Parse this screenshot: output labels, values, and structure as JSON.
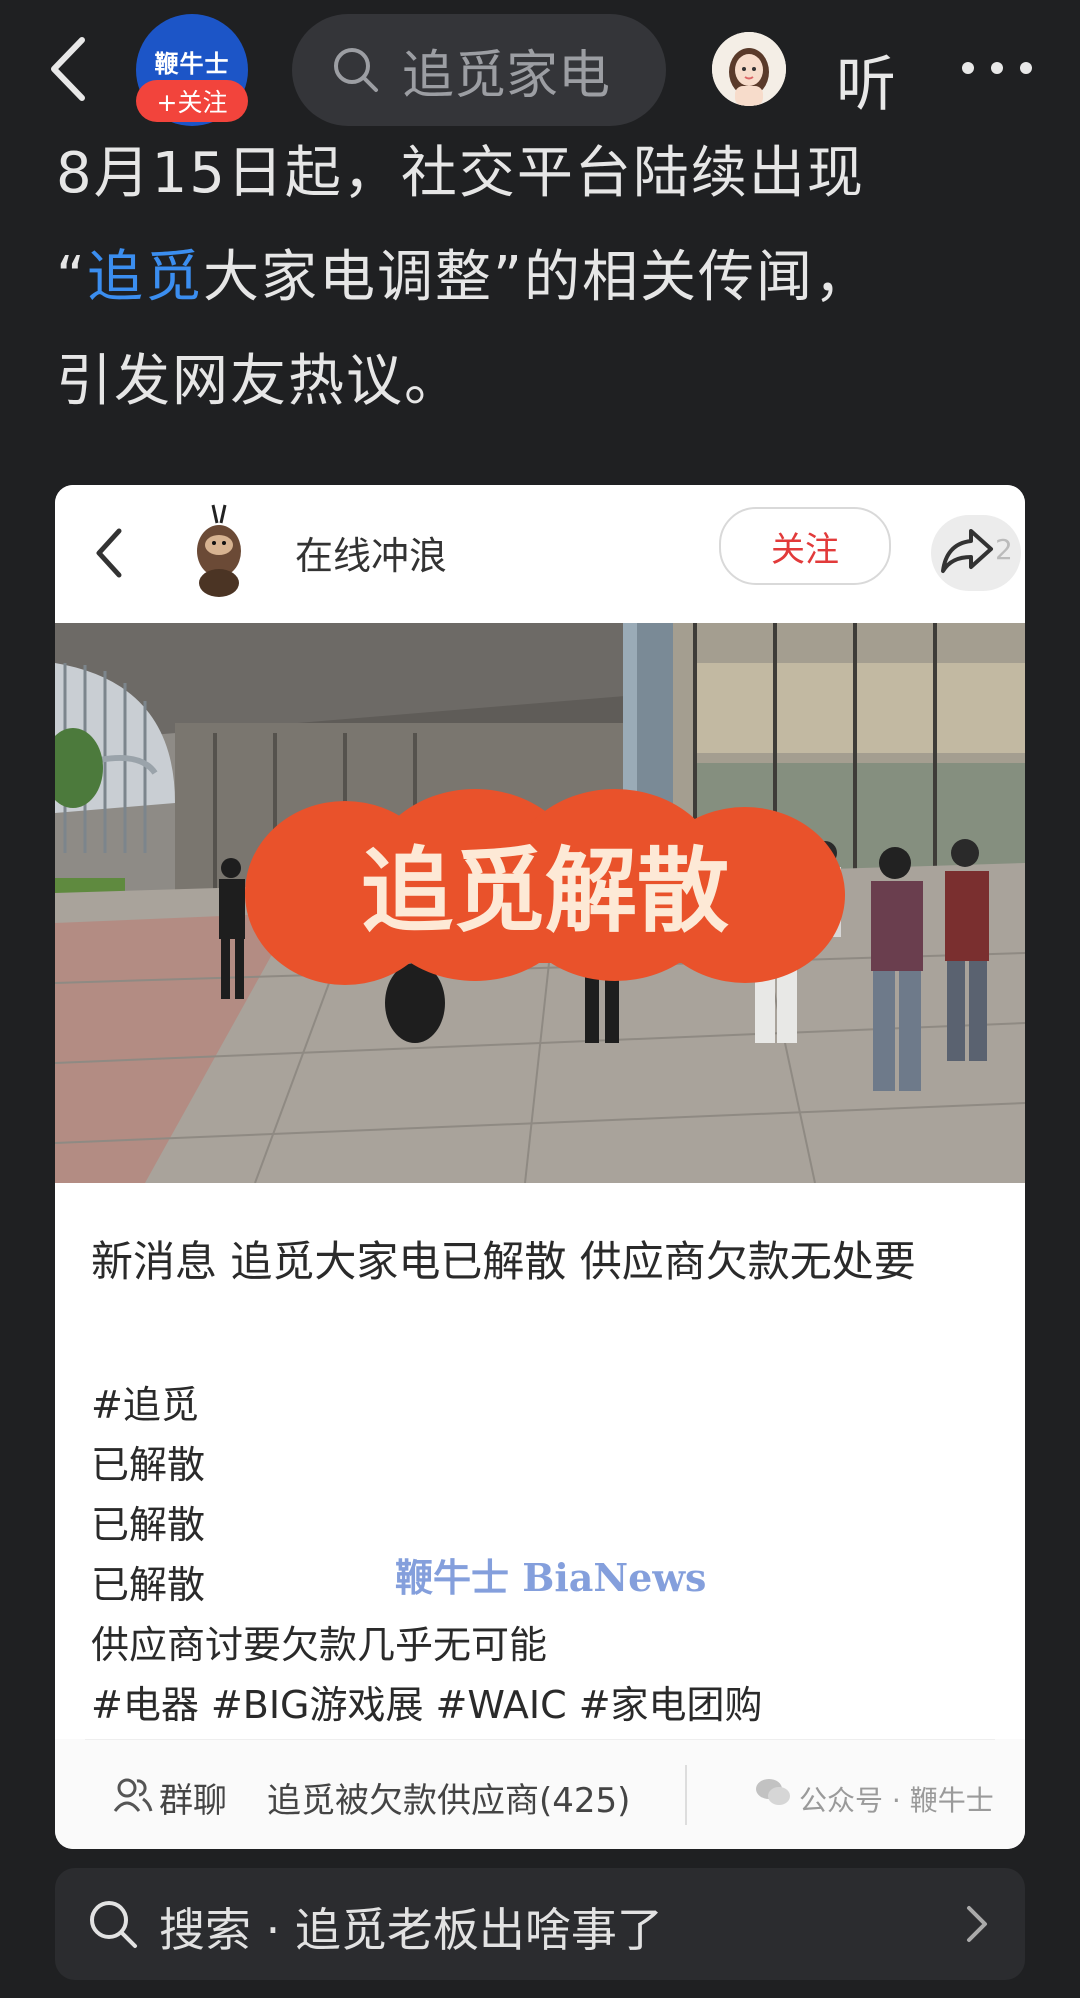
{
  "topbar": {
    "logo_text": "鞭牛士",
    "follow_label": "+关注",
    "search_text": "追觅家电",
    "listen_label": "听"
  },
  "article": {
    "line1": "8月15日起，社交平台陆续出现",
    "line2_open_quote": "“",
    "line2_link": "追觅",
    "line2_rest": "大家电调整”的相关传闻，",
    "line3": "引发网友热议。"
  },
  "card": {
    "account_name": "在线冲浪",
    "follow_label": "关注",
    "share_count": "2",
    "photo_overlay_text": "追觅解散",
    "title": "新消息 追觅大家电已解散 供应商欠款无处要",
    "lines": [
      "#追觅",
      "已解散",
      "已解散",
      "已解散",
      "供应商讨要欠款几乎无可能",
      "#电器 #BIG游戏展 #WAIC #家电团购"
    ],
    "watermark": "鞭牛士 BiaNews",
    "group_label": "群聊",
    "group_name": "追觅被欠款供应商(425)",
    "official_account": "公众号 · 鞭牛士"
  },
  "bottom_search": {
    "text": "搜索 · 追觅老板出啥事了"
  },
  "colors": {
    "background": "#1f2022",
    "link": "#3b8ef0",
    "follow_badge": "#f2443c",
    "logo": "#1c55c7",
    "photo_overlay": "#e9522b"
  },
  "icons": [
    "back-icon",
    "search-icon",
    "more-icon",
    "share-icon",
    "group-icon",
    "wechat-icon",
    "chevron-right-icon"
  ]
}
